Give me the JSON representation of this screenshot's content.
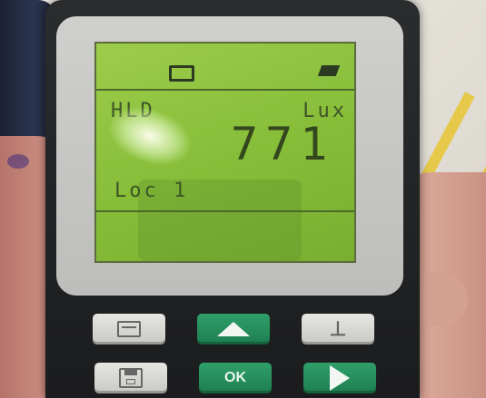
{
  "device": {
    "display": {
      "status_left": "",
      "status_right": "",
      "mode_label": "HLD",
      "unit_label": "Lux",
      "reading": "771",
      "location_label": "Loc 1"
    },
    "buttons": {
      "print": {
        "icon": "print-icon"
      },
      "up": {
        "icon": "arrow-up-icon"
      },
      "light": {
        "icon": "light-icon",
        "glyph": "⊥"
      },
      "save": {
        "icon": "save-icon"
      },
      "ok": {
        "label": "OK"
      },
      "right": {
        "icon": "arrow-right-icon"
      }
    },
    "colors": {
      "lcd_background": "#8fc53f",
      "button_green": "#1e7e50",
      "button_grey": "#d6d6d2",
      "body": "#1b1c1e"
    }
  }
}
